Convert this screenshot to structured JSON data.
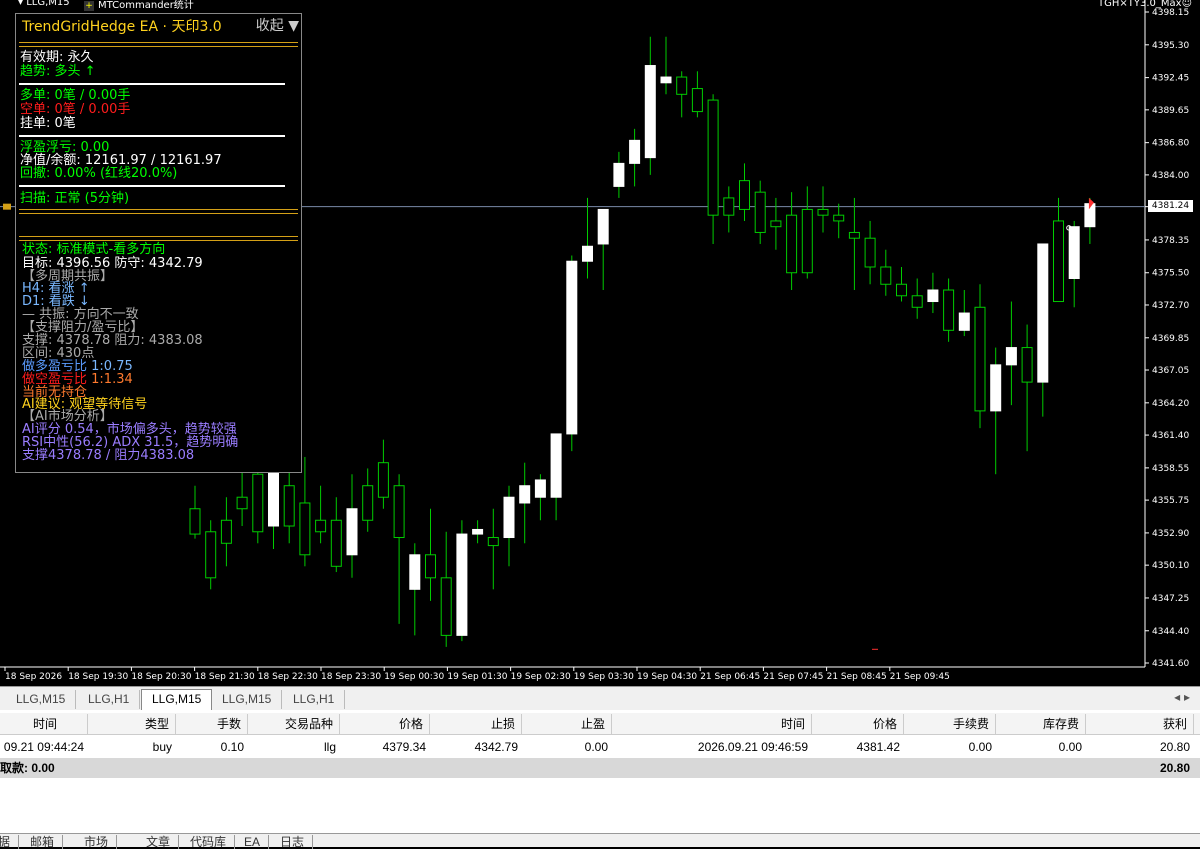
{
  "window": {
    "symbol_period": "LLG,M15",
    "plugin_label": "MTCommander统计",
    "ea_label": "TGH×TY3.0_Max☺"
  },
  "ea_panel": {
    "title": "TrendGridHedge EA · 天印3.0",
    "collapse_label": "收起 ▼",
    "validity": "有效期: 永久",
    "trend": "趋势: 多头 ↑",
    "long_orders": "多单: 0笔 / 0.00手",
    "short_orders": "空单: 0笔 / 0.00手",
    "pending_orders": "挂单: 0笔",
    "floating_pl": "浮盈浮亏: 0.00",
    "equity_balance": "净值/余额: 12161.97 / 12161.97",
    "drawdown": "回撤: 0.00% (红线20.0%)",
    "scan": "扫描: 正常 (5分钟)",
    "status": "状态: 标准模式-看多方向",
    "target": "目标: 4396.56  防守: 4342.79",
    "multi_tf_header": "【多周期共振】",
    "h4": "H4: 看涨 ↑",
    "d1": "D1: 看跌 ↓",
    "resonance": "— 共振: 方向不一致",
    "sr_header": "【支撑阻力/盈亏比】",
    "support_resistance": "支撑: 4378.78  阻力: 4383.08",
    "range": "区间: 430点",
    "long_rr_label": "做多盈亏比",
    "long_rr_value": "1:0.75",
    "short_rr_label": "做空盈亏比",
    "short_rr_value": "1:1.34",
    "position": "当前无持仓",
    "ai_advice": "AI建议: 观望等待信号",
    "ai_header": "【AI市场分析】",
    "ai_score": "AI评分 0.54，市场偏多头，趋势较强",
    "rsi_adx": "RSI中性(56.2) ADX 31.5，趋势明确",
    "ai_sr": "支撑4378.78 / 阻力4383.08"
  },
  "price_axis": [
    "4398.15",
    "4395.30",
    "4392.45",
    "4389.65",
    "4386.80",
    "4384.00",
    "4381.24",
    "4378.35",
    "4375.50",
    "4372.70",
    "4369.85",
    "4367.05",
    "4364.20",
    "4361.40",
    "4358.55",
    "4355.75",
    "4352.90",
    "4350.10",
    "4347.25",
    "4344.40",
    "4341.60"
  ],
  "current_price": "4381.24",
  "time_axis": [
    "18 Sep 2026",
    "18 Sep 19:30",
    "18 Sep 20:30",
    "18 Sep 21:30",
    "18 Sep 22:30",
    "18 Sep 23:30",
    "19 Sep 00:30",
    "19 Sep 01:30",
    "19 Sep 02:30",
    "19 Sep 03:30",
    "19 Sep 04:30",
    "21 Sep 06:45",
    "21 Sep 07:45",
    "21 Sep 08:45",
    "21 Sep 09:45"
  ],
  "chart_tabs": [
    "LLG,M15",
    "LLG,H1",
    "LLG,M15",
    "LLG,M15",
    "LLG,H1"
  ],
  "chart_tabs_active": 2,
  "terminal": {
    "headers": [
      "时间",
      "类型",
      "手数",
      "交易品种",
      "价格",
      "止损",
      "止盈",
      "时间",
      "价格",
      "手续费",
      "库存费",
      "获利"
    ],
    "order": {
      "open_time": "09.21 09:44:24",
      "type": "buy",
      "lots": "0.10",
      "symbol": "llg",
      "open_price": "4379.34",
      "sl": "4342.79",
      "tp": "0.00",
      "time": "2026.09.21 09:46:59",
      "price": "4381.42",
      "commission": "0.00",
      "swap": "0.00",
      "profit": "20.80"
    },
    "summary_label": "取款: 0.00",
    "summary_profit": "20.80"
  },
  "bottom_tabs": [
    "据",
    "邮箱",
    "市场",
    "文章",
    "代码库",
    "EA",
    "日志"
  ],
  "colors": {
    "bull_body": "#ffffff",
    "wick": "#00cc00",
    "ea_title": "#ffd21e",
    "panel_border": "#888888"
  },
  "chart_data": {
    "type": "candlestick",
    "series": [
      {
        "o": 4355.0,
        "h": 4357.0,
        "l": 4352.4,
        "c": 4352.8
      },
      {
        "o": 4353.0,
        "h": 4354.0,
        "l": 4348.0,
        "c": 4349.0
      },
      {
        "o": 4354.0,
        "h": 4356.0,
        "l": 4350.0,
        "c": 4352.0
      },
      {
        "o": 4356.0,
        "h": 4361.0,
        "l": 4353.5,
        "c": 4355.0
      },
      {
        "o": 4358.0,
        "h": 4359.2,
        "l": 4352.0,
        "c": 4353.0
      },
      {
        "o": 4353.5,
        "h": 4362.0,
        "l": 4351.5,
        "c": 4359.0
      },
      {
        "o": 4357.0,
        "h": 4360.0,
        "l": 4352.0,
        "c": 4353.5
      },
      {
        "o": 4355.5,
        "h": 4359.5,
        "l": 4350.0,
        "c": 4351.0
      },
      {
        "o": 4354.0,
        "h": 4357.0,
        "l": 4352.0,
        "c": 4353.0
      },
      {
        "o": 4354.0,
        "h": 4356.0,
        "l": 4349.5,
        "c": 4350.0
      },
      {
        "o": 4351.0,
        "h": 4358.0,
        "l": 4349.0,
        "c": 4355.0
      },
      {
        "o": 4357.0,
        "h": 4358.5,
        "l": 4353.0,
        "c": 4354.0
      },
      {
        "o": 4359.0,
        "h": 4361.0,
        "l": 4355.0,
        "c": 4356.0
      },
      {
        "o": 4357.0,
        "h": 4358.0,
        "l": 4345.0,
        "c": 4352.5
      },
      {
        "o": 4348.0,
        "h": 4352.0,
        "l": 4344.0,
        "c": 4351.0
      },
      {
        "o": 4351.0,
        "h": 4355.0,
        "l": 4347.0,
        "c": 4349.0
      },
      {
        "o": 4349.0,
        "h": 4353.0,
        "l": 4343.0,
        "c": 4344.0
      },
      {
        "o": 4344.0,
        "h": 4354.0,
        "l": 4343.5,
        "c": 4352.8
      },
      {
        "o": 4352.8,
        "h": 4354.0,
        "l": 4352.0,
        "c": 4353.2
      },
      {
        "o": 4352.5,
        "h": 4355.0,
        "l": 4348.0,
        "c": 4351.8
      },
      {
        "o": 4352.5,
        "h": 4357.0,
        "l": 4350.0,
        "c": 4356.0
      },
      {
        "o": 4355.5,
        "h": 4359.0,
        "l": 4352.0,
        "c": 4357.0
      },
      {
        "o": 4356.0,
        "h": 4358.0,
        "l": 4354.0,
        "c": 4357.5
      },
      {
        "o": 4356.0,
        "h": 4361.0,
        "l": 4354.0,
        "c": 4361.5
      },
      {
        "o": 4361.5,
        "h": 4377.0,
        "l": 4360.0,
        "c": 4376.5
      },
      {
        "o": 4376.5,
        "h": 4382.0,
        "l": 4375.0,
        "c": 4377.8
      },
      {
        "o": 4378.0,
        "h": 4381.0,
        "l": 4374.0,
        "c": 4381.0
      },
      {
        "o": 4383.0,
        "h": 4386.0,
        "l": 4382.0,
        "c": 4385.0
      },
      {
        "o": 4385.0,
        "h": 4388.0,
        "l": 4383.0,
        "c": 4387.0
      },
      {
        "o": 4385.5,
        "h": 4396.0,
        "l": 4384.0,
        "c": 4393.5
      },
      {
        "o": 4392.0,
        "h": 4396.0,
        "l": 4391.0,
        "c": 4392.5
      },
      {
        "o": 4392.5,
        "h": 4393.0,
        "l": 4389.0,
        "c": 4391.0
      },
      {
        "o": 4391.5,
        "h": 4393.0,
        "l": 4389.0,
        "c": 4389.5
      },
      {
        "o": 4390.5,
        "h": 4391.0,
        "l": 4378.0,
        "c": 4380.5
      },
      {
        "o": 4382.0,
        "h": 4383.0,
        "l": 4379.0,
        "c": 4380.5
      },
      {
        "o": 4383.5,
        "h": 4385.0,
        "l": 4380.0,
        "c": 4381.0
      },
      {
        "o": 4382.5,
        "h": 4383.5,
        "l": 4378.0,
        "c": 4379.0
      },
      {
        "o": 4380.0,
        "h": 4382.0,
        "l": 4377.5,
        "c": 4379.5
      },
      {
        "o": 4380.5,
        "h": 4382.5,
        "l": 4374.0,
        "c": 4375.5
      },
      {
        "o": 4381.0,
        "h": 4383.0,
        "l": 4375.0,
        "c": 4375.5
      },
      {
        "o": 4381.0,
        "h": 4383.0,
        "l": 4379.0,
        "c": 4380.5
      },
      {
        "o": 4380.5,
        "h": 4381.5,
        "l": 4378.5,
        "c": 4380.0
      },
      {
        "o": 4379.0,
        "h": 4382.0,
        "l": 4374.0,
        "c": 4378.5
      },
      {
        "o": 4378.5,
        "h": 4380.0,
        "l": 4374.5,
        "c": 4376.0
      },
      {
        "o": 4376.0,
        "h": 4377.5,
        "l": 4373.5,
        "c": 4374.5
      },
      {
        "o": 4374.5,
        "h": 4376.0,
        "l": 4373.0,
        "c": 4373.5
      },
      {
        "o": 4373.5,
        "h": 4375.0,
        "l": 4371.5,
        "c": 4372.5
      },
      {
        "o": 4373.0,
        "h": 4375.5,
        "l": 4372.0,
        "c": 4374.0
      },
      {
        "o": 4374.0,
        "h": 4375.0,
        "l": 4369.5,
        "c": 4370.5
      },
      {
        "o": 4370.5,
        "h": 4374.0,
        "l": 4370.0,
        "c": 4372.0
      },
      {
        "o": 4372.5,
        "h": 4374.5,
        "l": 4362.0,
        "c": 4363.5
      },
      {
        "o": 4363.5,
        "h": 4369.0,
        "l": 4358.0,
        "c": 4367.5
      },
      {
        "o": 4367.5,
        "h": 4373.0,
        "l": 4364.0,
        "c": 4369.0
      },
      {
        "o": 4369.0,
        "h": 4371.0,
        "l": 4360.0,
        "c": 4366.0
      },
      {
        "o": 4366.0,
        "h": 4378.0,
        "l": 4363.0,
        "c": 4378.0
      },
      {
        "o": 4380.0,
        "h": 4382.0,
        "l": 4373.0,
        "c": 4373.0
      },
      {
        "o": 4375.0,
        "h": 4380.0,
        "l": 4372.5,
        "c": 4379.5
      },
      {
        "o": 4379.5,
        "h": 4382.0,
        "l": 4378.0,
        "c": 4381.5
      }
    ]
  }
}
